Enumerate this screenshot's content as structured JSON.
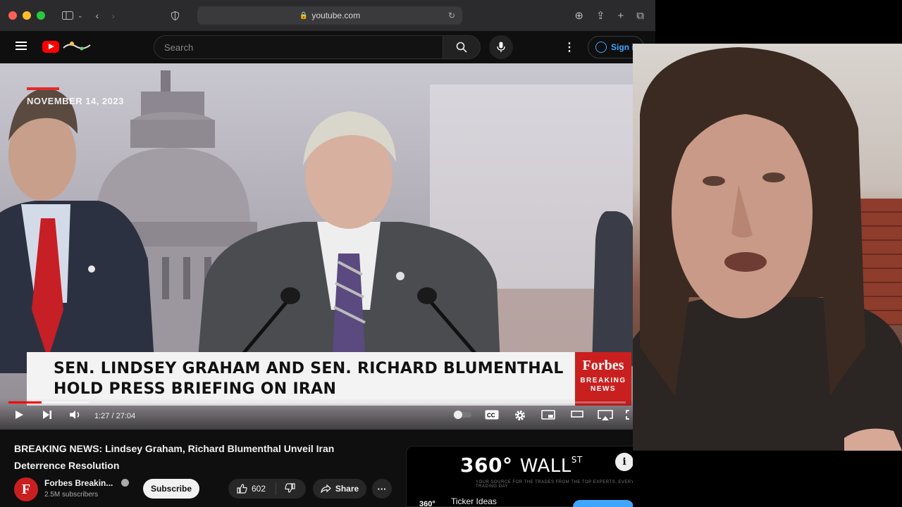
{
  "browser": {
    "url": "youtube.com",
    "traffic_colors": [
      "#ff5f57",
      "#febc2e",
      "#28c840"
    ]
  },
  "youtube": {
    "search_placeholder": "Search",
    "signin_label": "Sign in"
  },
  "video": {
    "date_overlay": "NOVEMBER 14, 2023",
    "lower_third_line1": "SEN. LINDSEY GRAHAM AND SEN. RICHARD BLUMENTHAL",
    "lower_third_line2": "HOLD PRESS BRIEFING ON IRAN",
    "brand_name": "Forbes",
    "brand_sub1": "BREAKING",
    "brand_sub2": "NEWS",
    "time_display": "1:27 / 27:04",
    "progress_played": 0.054,
    "progress_buffered": 0.13
  },
  "details": {
    "title_line1": "BREAKING NEWS: Lindsey Graham, Richard Blumenthal Unveil Iran",
    "title_line2": "Deterrence Resolution",
    "channel_initial": "F",
    "channel_name": "Forbes Breakin...",
    "subscribers": "2.5M subscribers",
    "subscribe_label": "Subscribe",
    "like_count": "602",
    "share_label": "Share"
  },
  "ad": {
    "logo_num": "360°",
    "logo_text": "WALL",
    "logo_sup": "ST",
    "tagline": "YOUR SOURCE FOR THE TRADES FROM THE TOP EXPERTS. EVERY TRADING DAY",
    "small_logo": "360°",
    "ticker_label": "Ticker Ideas"
  }
}
